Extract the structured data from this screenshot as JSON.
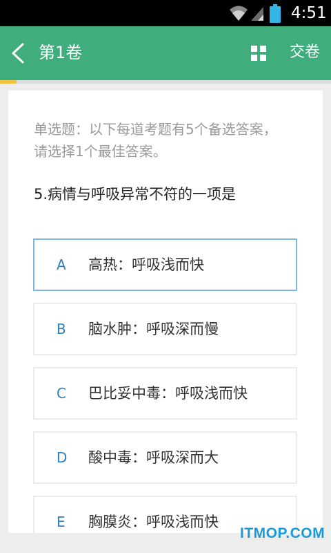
{
  "status_bar": {
    "time": "4:51"
  },
  "app_bar": {
    "title": "第1卷",
    "submit_label": "交卷"
  },
  "progress": {
    "fraction": 0.05
  },
  "question": {
    "instruction": "单选题：以下每道考题有5个备选答案，请选择1个最佳答案。",
    "text": "5.病情与呼吸异常不符的一项是",
    "options": [
      {
        "letter": "A",
        "text": "高热：呼吸浅而快",
        "selected": true
      },
      {
        "letter": "B",
        "text": "脑水肿：呼吸深而慢",
        "selected": false
      },
      {
        "letter": "C",
        "text": "巴比妥中毒：呼吸浅而快",
        "selected": false
      },
      {
        "letter": "D",
        "text": "酸中毒：呼吸深而大",
        "selected": false
      },
      {
        "letter": "E",
        "text": "胸膜炎：呼吸浅而快",
        "selected": false
      }
    ]
  },
  "watermark": "ITMOP.COM",
  "colors": {
    "accent": "#3fae7c",
    "progress": "#f3c13a",
    "option_letter": "#2e7fc0",
    "selected_border": "#7fb8db"
  }
}
